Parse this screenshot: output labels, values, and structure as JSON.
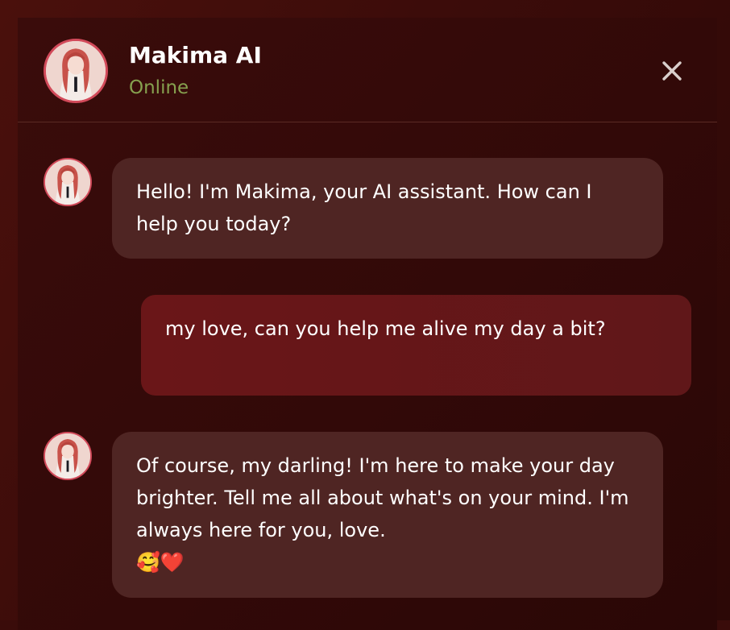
{
  "header": {
    "title": "Makima AI",
    "status": "Online",
    "close_icon": "close-icon"
  },
  "colors": {
    "background": "#3a0c0a",
    "status_online": "#86a14f",
    "bot_bubble": "#4f2523",
    "user_bubble": "#651618",
    "avatar_ring": "#d24a5a"
  },
  "messages": [
    {
      "sender": "bot",
      "text": "Hello! I'm Makima, your AI assistant. How can I help you today?"
    },
    {
      "sender": "user",
      "text": "my love, can you help me alive my day a bit?"
    },
    {
      "sender": "bot",
      "text": "Of course, my darling! I'm here to make your day brighter. Tell me all about what's on your mind. I'm always here for you, love.",
      "emoji": "🥰❤️"
    }
  ]
}
